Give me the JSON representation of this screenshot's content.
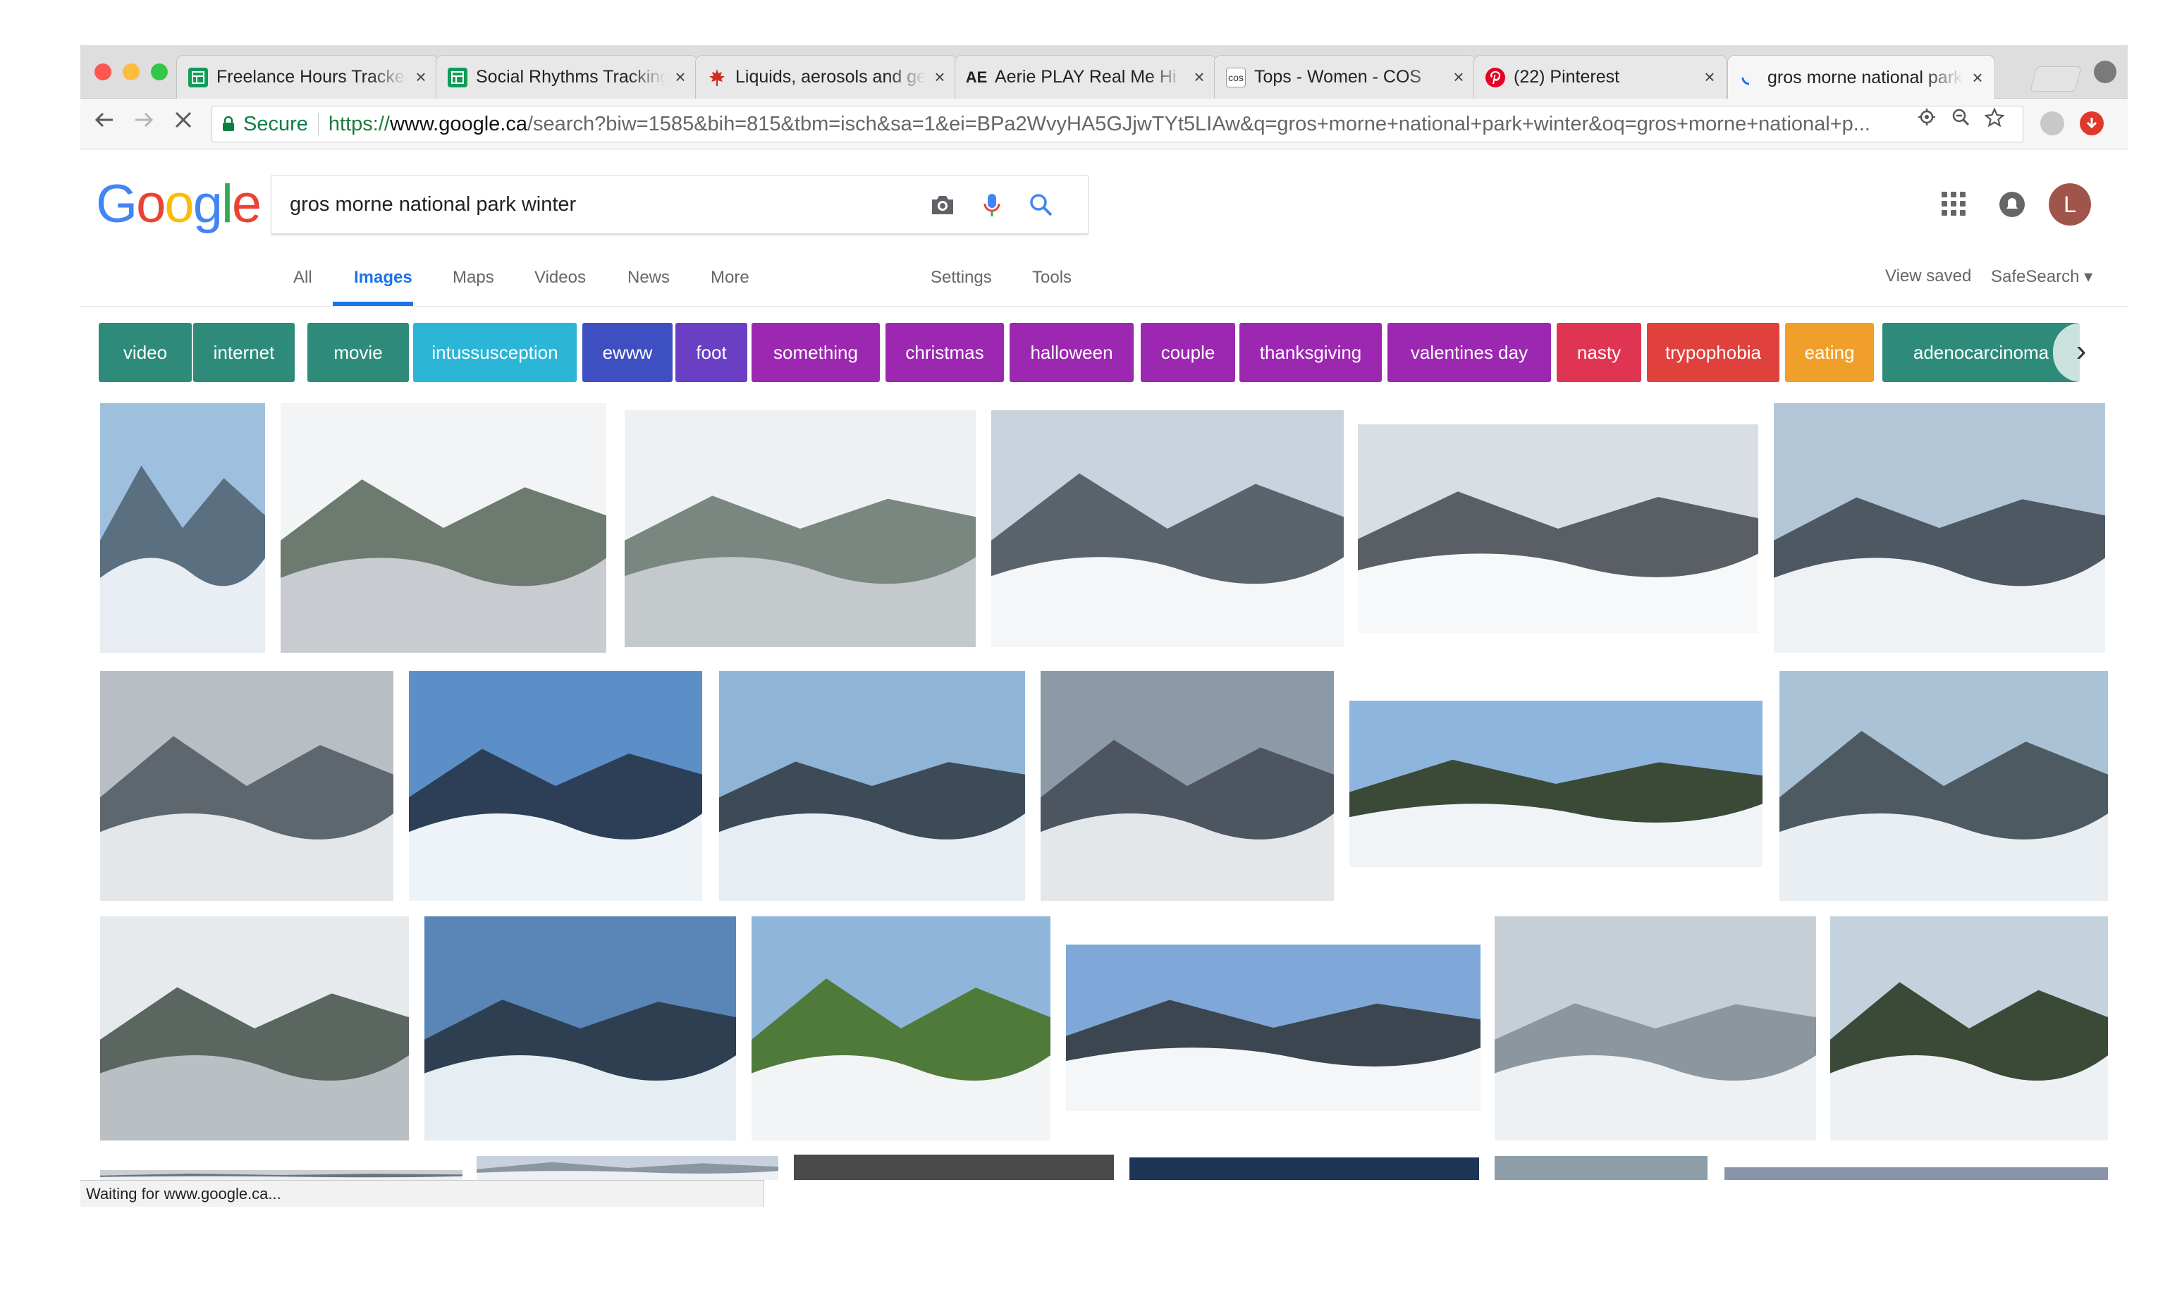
{
  "browser": {
    "tabs": [
      {
        "title": "Freelance Hours Tracker",
        "favicon": "sheets-icon",
        "color": "#0f9d58"
      },
      {
        "title": "Social Rhythms Tracking",
        "favicon": "sheets-icon",
        "color": "#0f9d58"
      },
      {
        "title": "Liquids, aerosols and gels",
        "favicon": "maple-leaf-icon",
        "color": "#d52b1e"
      },
      {
        "title": "Aerie PLAY Real Me Hi",
        "favicon": "ae-icon",
        "color": "#222222"
      },
      {
        "title": "Tops - Women - COS",
        "favicon": "cos-icon",
        "color": "#333333"
      },
      {
        "title": "(22) Pinterest",
        "favicon": "pinterest-icon",
        "color": "#e60023"
      },
      {
        "title": "gros morne national park winter",
        "favicon": "loading-icon",
        "color": "#1a73e8"
      }
    ],
    "ae_glyph": "AE",
    "cos_glyph": "cos",
    "close_glyph": "×",
    "secure_label": "Secure",
    "url_scheme": "https://",
    "url_host": "www.google.ca",
    "url_rest": "/search?biw=1585&bih=815&tbm=isch&sa=1&ei=BPa2WvyHA5GJjwTYt5LIAw&q=gros+morne+national+park+winter&oq=gros+morne+national+p...",
    "status_text": "Waiting for www.google.ca..."
  },
  "google": {
    "logo": [
      "G",
      "o",
      "o",
      "g",
      "l",
      "e"
    ],
    "query": "gros morne national park winter",
    "avatar_letter": "L",
    "nav_tabs": [
      "All",
      "Images",
      "Maps",
      "Videos",
      "News",
      "More",
      "Settings",
      "Tools"
    ],
    "view_saved": "View saved",
    "safesearch": "SafeSearch ▾"
  },
  "chips": [
    {
      "label": "video",
      "color": "#2e8b7a"
    },
    {
      "label": "internet",
      "color": "#2e8b7a"
    },
    {
      "label": "movie",
      "color": "#2e8b7a"
    },
    {
      "label": "intussusception",
      "color": "#2bb5d6"
    },
    {
      "label": "ewww",
      "color": "#3e4fc2"
    },
    {
      "label": "foot",
      "color": "#6a3fc4"
    },
    {
      "label": "something",
      "color": "#9c27b0"
    },
    {
      "label": "christmas",
      "color": "#9c27b0"
    },
    {
      "label": "halloween",
      "color": "#9c27b0"
    },
    {
      "label": "couple",
      "color": "#9c27b0"
    },
    {
      "label": "thanksgiving",
      "color": "#9c27b0"
    },
    {
      "label": "valentines day",
      "color": "#9c27b0"
    },
    {
      "label": "nasty",
      "color": "#e03552"
    },
    {
      "label": "trypophobia",
      "color": "#e0413c"
    },
    {
      "label": "eating",
      "color": "#f0a02a"
    },
    {
      "label": "adenocarcinoma",
      "color": "#2e8b7a"
    }
  ],
  "images": [
    {
      "name": "snowy-boardwalk-lake",
      "palette": [
        "#9fbfdf",
        "#e8eef3",
        "#5a6f80"
      ]
    },
    {
      "name": "snow-forest-skier",
      "palette": [
        "#f2f4f5",
        "#c8ccd0",
        "#6c7a70"
      ]
    },
    {
      "name": "snow-trail-snowshoer",
      "palette": [
        "#eef1f3",
        "#c4c9cc",
        "#7a8680"
      ]
    },
    {
      "name": "mountain-snow-valley",
      "palette": [
        "#c9d3dd",
        "#f4f6f7",
        "#5a636c"
      ]
    },
    {
      "name": "couple-snowmobile-suits",
      "palette": [
        "#d8dee4",
        "#f7f8f9",
        "#5a5f66"
      ]
    },
    {
      "name": "climber-cliff-fjord",
      "palette": [
        "#b3c6d8",
        "#eef2f5",
        "#4d5862"
      ]
    },
    {
      "name": "foggy-fjord-valley",
      "palette": [
        "#b8bec4",
        "#e4e7ea",
        "#5f676e"
      ]
    },
    {
      "name": "skiers-blue-lake",
      "palette": [
        "#5c8fc8",
        "#eef3f8",
        "#2d3f57"
      ]
    },
    {
      "name": "fjord-snow-cliffs",
      "palette": [
        "#8fb4d6",
        "#e6edf3",
        "#3d4a58"
      ]
    },
    {
      "name": "grey-sky-fjord",
      "palette": [
        "#8c9aa8",
        "#e3e7ea",
        "#4d5660"
      ]
    },
    {
      "name": "snowshoers-red-jackets",
      "palette": [
        "#8eb5dd",
        "#f1f4f7",
        "#3a4a36"
      ]
    },
    {
      "name": "coastal-ice-rocks",
      "palette": [
        "#a9c2d6",
        "#e9eef2",
        "#4e5a62"
      ]
    },
    {
      "name": "snowy-trees-hiker",
      "palette": [
        "#e7eaec",
        "#b9bfc3",
        "#5b6660"
      ]
    },
    {
      "name": "blue-fjord-wide",
      "palette": [
        "#5a86b7",
        "#e6edf3",
        "#2f3f52"
      ]
    },
    {
      "name": "green-fjord-summer",
      "palette": [
        "#8fb6da",
        "#f2f4f5",
        "#4f7a3a"
      ]
    },
    {
      "name": "snowmobile-jump",
      "palette": [
        "#7fa8d8",
        "#f4f6f8",
        "#3b4650"
      ]
    },
    {
      "name": "snow-slope-texture",
      "palette": [
        "#c7cfd6",
        "#eef1f3",
        "#8b969f"
      ]
    },
    {
      "name": "fat-bike-riders",
      "palette": [
        "#c3d2dc",
        "#eef1f3",
        "#3a4a36"
      ]
    },
    {
      "name": "partial-thumb-1",
      "palette": [
        "#c9cfd4",
        "#eef1f3",
        "#6b747c"
      ]
    },
    {
      "name": "partial-thumb-2",
      "palette": [
        "#c8d2dc",
        "#eef1f3",
        "#8a96a2"
      ]
    },
    {
      "name": "placeholder-dark-grey",
      "palette": [
        "#4a4a4a"
      ]
    },
    {
      "name": "placeholder-navy",
      "palette": [
        "#1d3557"
      ]
    },
    {
      "name": "placeholder-grey-blue",
      "palette": [
        "#8e9ea8"
      ]
    },
    {
      "name": "placeholder-slate",
      "palette": [
        "#8a94a8"
      ]
    }
  ]
}
